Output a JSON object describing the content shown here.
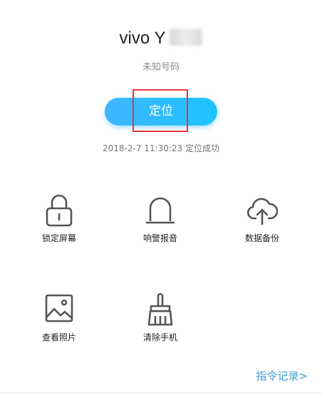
{
  "device": {
    "name": "vivo Y",
    "phone_number": "未知号码"
  },
  "locate": {
    "button_label": "定位",
    "status": "2018-2-7 11:30:23 定位成功"
  },
  "actions": [
    {
      "label": "锁定屏幕",
      "icon": "lock-icon"
    },
    {
      "label": "响警报音",
      "icon": "alarm-bell-icon"
    },
    {
      "label": "数据备份",
      "icon": "cloud-upload-icon"
    },
    {
      "label": "查看照片",
      "icon": "photo-icon"
    },
    {
      "label": "清除手机",
      "icon": "brush-icon"
    }
  ],
  "footer": {
    "history_link": "指令记录>"
  },
  "colors": {
    "accent": "#1ec4ff",
    "highlight": "#e03a3a",
    "link": "#3a9bd8"
  }
}
